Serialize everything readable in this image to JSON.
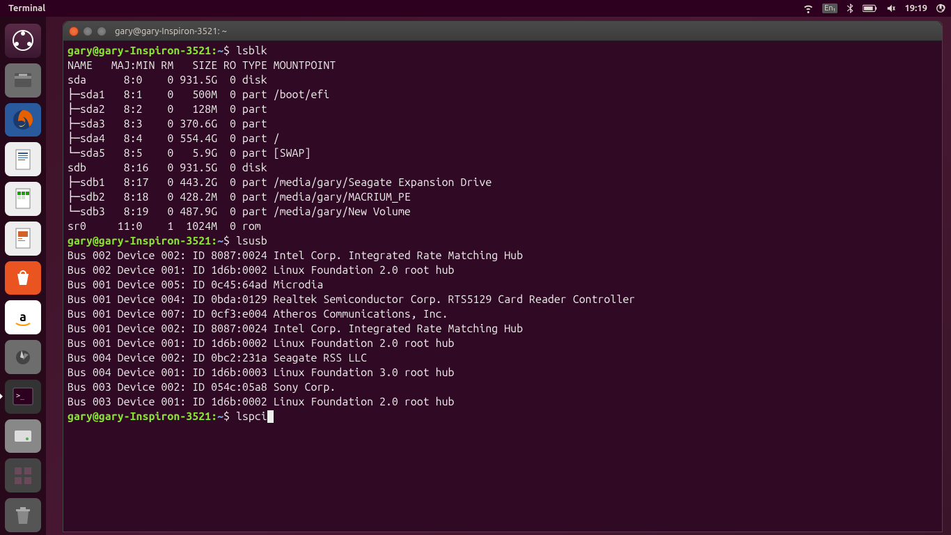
{
  "top_panel": {
    "title": "Terminal",
    "lang": "En₁",
    "time": "19:19"
  },
  "launcher": {
    "items": [
      {
        "name": "dash"
      },
      {
        "name": "files"
      },
      {
        "name": "firefox"
      },
      {
        "name": "writer"
      },
      {
        "name": "calc"
      },
      {
        "name": "impress"
      },
      {
        "name": "software"
      },
      {
        "name": "amazon"
      },
      {
        "name": "settings"
      },
      {
        "name": "terminal",
        "active": true
      },
      {
        "name": "disks"
      },
      {
        "name": "workspace"
      },
      {
        "name": "trash"
      }
    ]
  },
  "terminal": {
    "window_title": "gary@gary-Inspiron-3521: ~",
    "prompt_user": "gary@gary-Inspiron-3521",
    "prompt_path": "~",
    "prompt_symbol": "$",
    "commands": {
      "cmd1": "lsblk",
      "cmd2": "lsusb",
      "cmd3": "lspci"
    },
    "lsblk_header": "NAME   MAJ:MIN RM   SIZE RO TYPE MOUNTPOINT",
    "lsblk_rows": [
      "sda      8:0    0 931.5G  0 disk ",
      "├─sda1   8:1    0   500M  0 part /boot/efi",
      "├─sda2   8:2    0   128M  0 part ",
      "├─sda3   8:3    0 370.6G  0 part ",
      "├─sda4   8:4    0 554.4G  0 part /",
      "└─sda5   8:5    0   5.9G  0 part [SWAP]",
      "sdb      8:16   0 931.5G  0 disk ",
      "├─sdb1   8:17   0 443.2G  0 part /media/gary/Seagate Expansion Drive",
      "├─sdb2   8:18   0 428.2M  0 part /media/gary/MACRIUM_PE",
      "└─sdb3   8:19   0 487.9G  0 part /media/gary/New Volume",
      "sr0     11:0    1  1024M  0 rom  "
    ],
    "lsusb_rows": [
      "Bus 002 Device 002: ID 8087:0024 Intel Corp. Integrated Rate Matching Hub",
      "Bus 002 Device 001: ID 1d6b:0002 Linux Foundation 2.0 root hub",
      "Bus 001 Device 005: ID 0c45:64ad Microdia ",
      "Bus 001 Device 004: ID 0bda:0129 Realtek Semiconductor Corp. RTS5129 Card Reader Controller",
      "Bus 001 Device 007: ID 0cf3:e004 Atheros Communications, Inc. ",
      "Bus 001 Device 002: ID 8087:0024 Intel Corp. Integrated Rate Matching Hub",
      "Bus 001 Device 001: ID 1d6b:0002 Linux Foundation 2.0 root hub",
      "Bus 004 Device 002: ID 0bc2:231a Seagate RSS LLC ",
      "Bus 004 Device 001: ID 1d6b:0003 Linux Foundation 3.0 root hub",
      "Bus 003 Device 002: ID 054c:05a8 Sony Corp. ",
      "Bus 003 Device 001: ID 1d6b:0002 Linux Foundation 2.0 root hub"
    ]
  }
}
